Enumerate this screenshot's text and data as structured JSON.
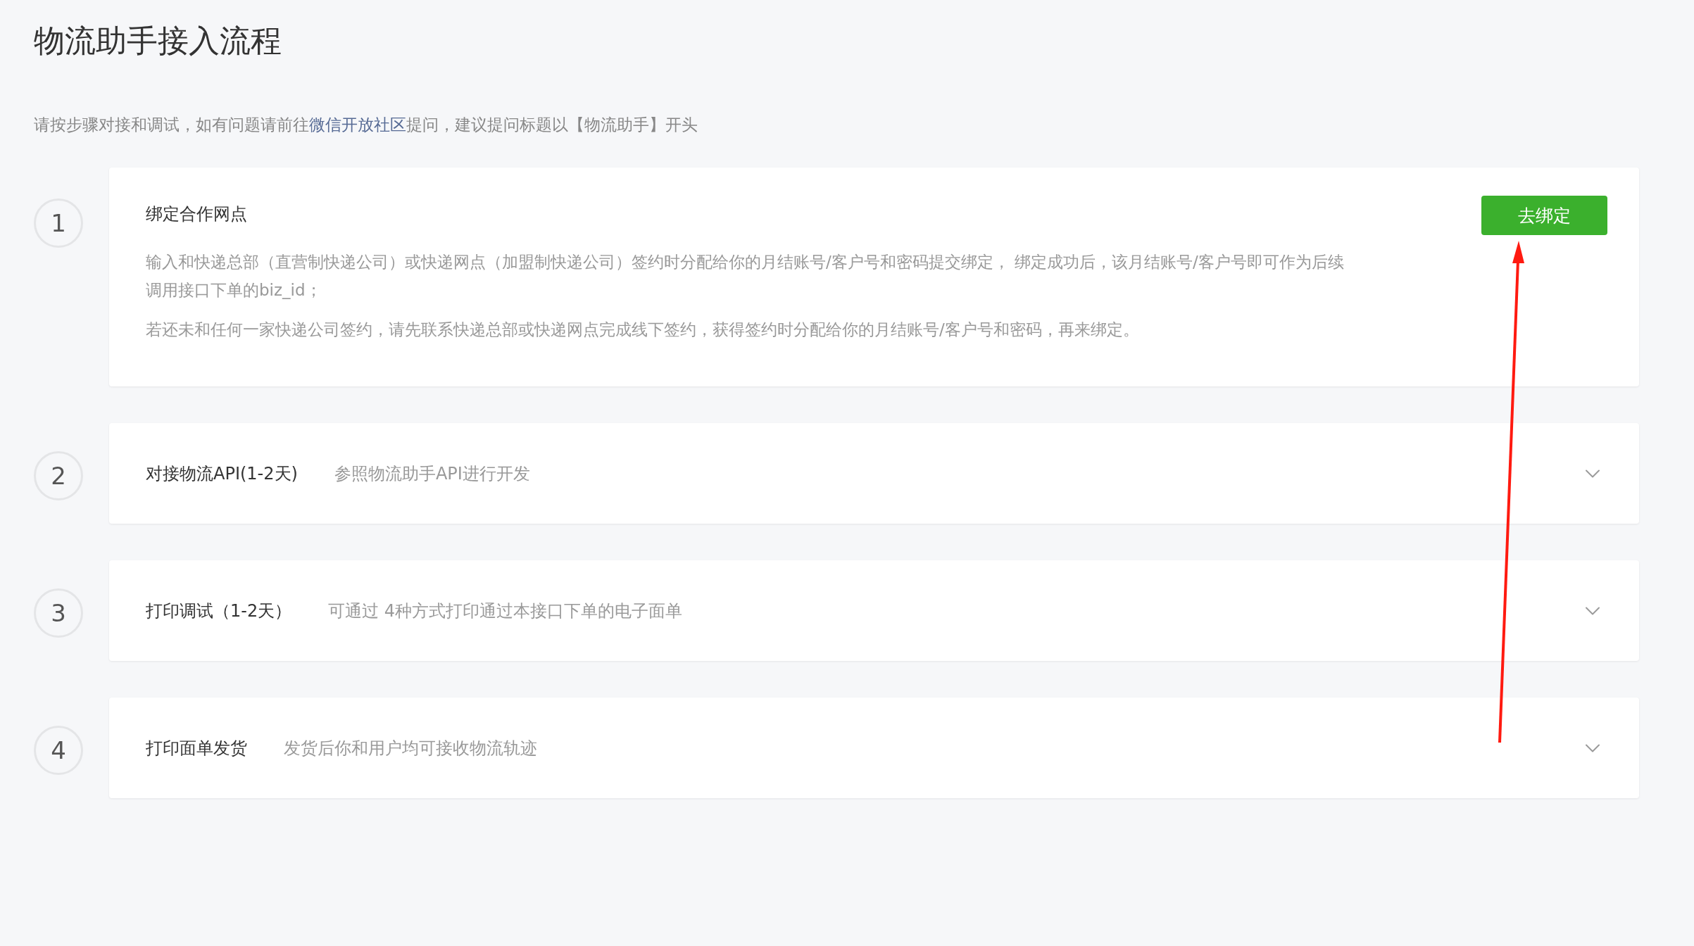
{
  "page": {
    "title": "物流助手接入流程",
    "intro": "请按步骤对接和调试，如有问题请前往",
    "intro_link": "微信开放社区",
    "intro_tail": "提问，建议提问标题以【物流助手】开头"
  },
  "steps": [
    {
      "number": "1",
      "title": "绑定合作网点",
      "expanded": true,
      "button": "去绑定",
      "paragraphs": [
        "输入和快递总部（直营制快递公司）或快递网点（加盟制快递公司）签约时分配给你的月结账号/客户号和密码提交绑定， 绑定成功后，该月结账号/客户号即可作为后续调用接口下单的biz_id；",
        "若还未和任何一家快递公司签约，请先联系快递总部或快递网点完成线下签约，获得签约时分配给你的月结账号/客户号和密码，再来绑定。"
      ]
    },
    {
      "number": "2",
      "title": "对接物流API(1-2天)",
      "expanded": false,
      "summary": "参照物流助手API进行开发"
    },
    {
      "number": "3",
      "title": "打印调试（1-2天）",
      "expanded": false,
      "summary": "可通过 4种方式打印通过本接口下单的电子面单"
    },
    {
      "number": "4",
      "title": "打印面单发货",
      "expanded": false,
      "summary": "发货后你和用户均可接收物流轨迹"
    }
  ]
}
